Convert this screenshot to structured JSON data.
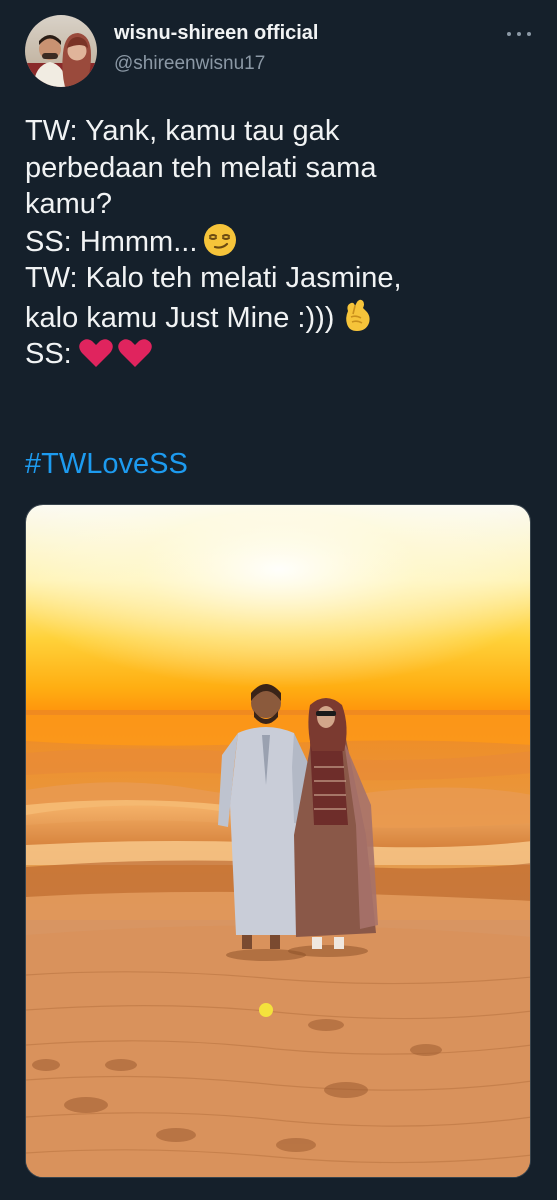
{
  "author": {
    "display_name": "wisnu-shireen official",
    "handle": "@shireenwisnu17"
  },
  "tweet": {
    "lines": [
      "TW: Yank, kamu tau gak",
      "perbedaan teh melati sama",
      "kamu?",
      "SS: Hmmm...",
      "TW: Kalo teh melati Jasmine,",
      "kalo kamu Just Mine :)))",
      "SS:"
    ],
    "hashtag": "#TWLoveSS"
  },
  "icons": {
    "more": "more-horizontal-icon",
    "emoji_line4": "smirking-face-emoji",
    "emoji_line6": "crossed-fingers-heart-hand-emoji",
    "emoji_line7": "two-red-hearts-emoji"
  },
  "media": {
    "kind": "photo",
    "subject": "couple-standing-in-desert-at-sunset"
  },
  "colors": {
    "background": "#15202b",
    "text": "#f1f3f4",
    "secondary_text": "#8b98a5",
    "link": "#1d9bf0",
    "heart": "#e0245e"
  }
}
